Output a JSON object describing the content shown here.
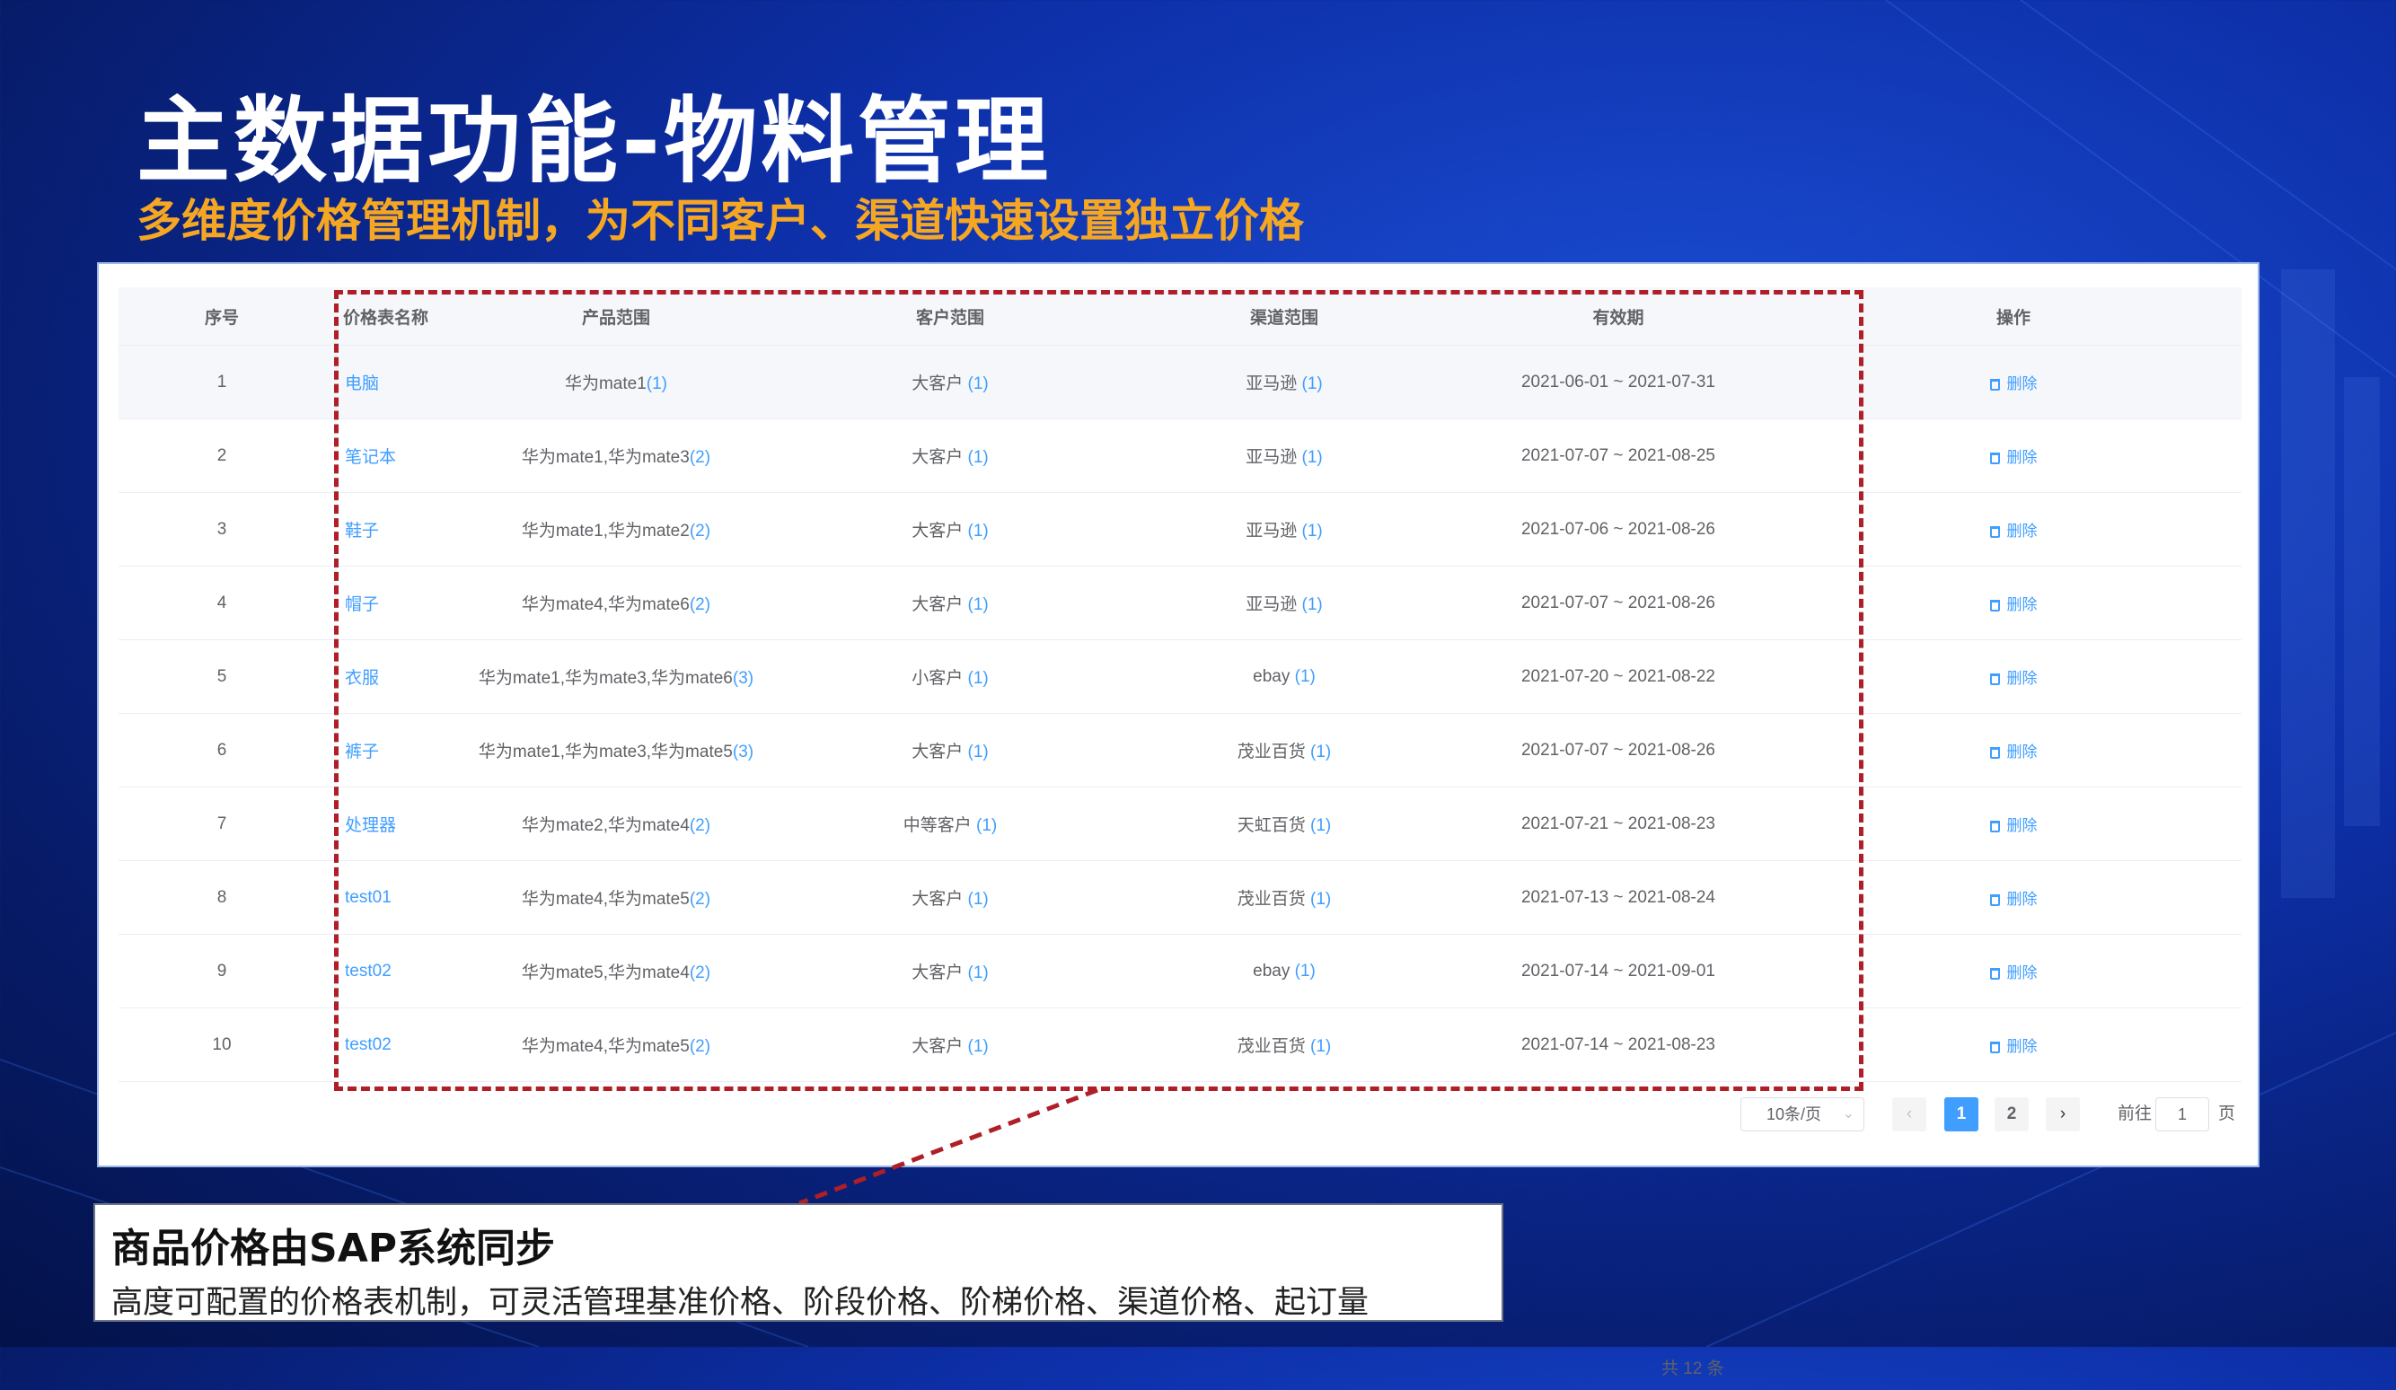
{
  "slide": {
    "title": "主数据功能-物料管理",
    "subtitle": "多维度价格管理机制，为不同客户、渠道快速设置独立价格"
  },
  "table": {
    "headers": [
      "序号",
      "价格表名称",
      "产品范围",
      "客户范围",
      "渠道范围",
      "有效期",
      "操作"
    ],
    "action_label": "删除",
    "rows": [
      {
        "index": "1",
        "name": "电脑",
        "products": "华为mate1",
        "products_count": "(1)",
        "customers": "大客户",
        "customers_count": "(1)",
        "channels": "亚马逊",
        "channels_count": "(1)",
        "period": "2021-06-01 ~ 2021-07-31"
      },
      {
        "index": "2",
        "name": "笔记本",
        "products": "华为mate1,华为mate3",
        "products_count": "(2)",
        "customers": "大客户",
        "customers_count": "(1)",
        "channels": "亚马逊",
        "channels_count": "(1)",
        "period": "2021-07-07 ~ 2021-08-25"
      },
      {
        "index": "3",
        "name": "鞋子",
        "products": "华为mate1,华为mate2",
        "products_count": "(2)",
        "customers": "大客户",
        "customers_count": "(1)",
        "channels": "亚马逊",
        "channels_count": "(1)",
        "period": "2021-07-06 ~ 2021-08-26"
      },
      {
        "index": "4",
        "name": "帽子",
        "products": "华为mate4,华为mate6",
        "products_count": "(2)",
        "customers": "大客户",
        "customers_count": "(1)",
        "channels": "亚马逊",
        "channels_count": "(1)",
        "period": "2021-07-07 ~ 2021-08-26"
      },
      {
        "index": "5",
        "name": "衣服",
        "products": "华为mate1,华为mate3,华为mate6",
        "products_count": "(3)",
        "customers": "小客户",
        "customers_count": "(1)",
        "channels": "ebay",
        "channels_count": "(1)",
        "period": "2021-07-20 ~ 2021-08-22"
      },
      {
        "index": "6",
        "name": "裤子",
        "products": "华为mate1,华为mate3,华为mate5",
        "products_count": "(3)",
        "customers": "大客户",
        "customers_count": "(1)",
        "channels": "茂业百货",
        "channels_count": "(1)",
        "period": "2021-07-07 ~ 2021-08-26"
      },
      {
        "index": "7",
        "name": "处理器",
        "products": "华为mate2,华为mate4",
        "products_count": "(2)",
        "customers": "中等客户",
        "customers_count": "(1)",
        "channels": "天虹百货",
        "channels_count": "(1)",
        "period": "2021-07-21 ~ 2021-08-23"
      },
      {
        "index": "8",
        "name": "test01",
        "products": "华为mate4,华为mate5",
        "products_count": "(2)",
        "customers": "大客户",
        "customers_count": "(1)",
        "channels": "茂业百货",
        "channels_count": "(1)",
        "period": "2021-07-13 ~ 2021-08-24"
      },
      {
        "index": "9",
        "name": "test02",
        "products": "华为mate5,华为mate4",
        "products_count": "(2)",
        "customers": "大客户",
        "customers_count": "(1)",
        "channels": "ebay",
        "channels_count": "(1)",
        "period": "2021-07-14 ~ 2021-09-01"
      },
      {
        "index": "10",
        "name": "test02",
        "products": "华为mate4,华为mate5",
        "products_count": "(2)",
        "customers": "大客户",
        "customers_count": "(1)",
        "channels": "茂业百货",
        "channels_count": "(1)",
        "period": "2021-07-14 ~ 2021-08-23"
      }
    ]
  },
  "pagination": {
    "total": "共 12 条",
    "page_size": "10条/页",
    "prev": "‹",
    "pages": [
      "1",
      "2"
    ],
    "current_page": "1",
    "next": "›",
    "goto_label": "前往",
    "goto_value": "1",
    "goto_unit": "页"
  },
  "callout": {
    "title": "商品价格由SAP系统同步",
    "text": "高度可配置的价格表机制，可灵活管理基准价格、阶段价格、阶梯价格、渠道价格、起订量"
  },
  "colors": {
    "link": "#409eff",
    "highlight_border": "#b01e28",
    "subtitle": "#f5a623",
    "background": "#0d2fa8"
  }
}
